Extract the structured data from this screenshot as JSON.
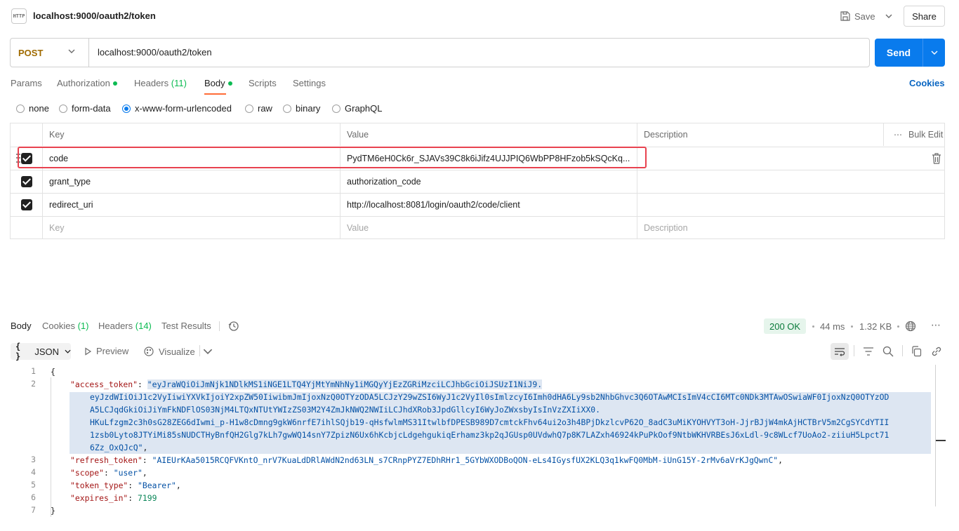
{
  "header": {
    "icon_text": "HTTP",
    "title": "localhost:9000/oauth2/token",
    "save_label": "Save",
    "share_label": "Share"
  },
  "request": {
    "method": "POST",
    "url": "localhost:9000/oauth2/token",
    "send_label": "Send"
  },
  "request_tabs": [
    {
      "label": "Params",
      "active": false
    },
    {
      "label": "Authorization",
      "dot": true
    },
    {
      "label": "Headers",
      "count": "(11)"
    },
    {
      "label": "Body",
      "dot": true,
      "active": true
    },
    {
      "label": "Scripts"
    },
    {
      "label": "Settings"
    }
  ],
  "cookies_link": "Cookies",
  "body_types": [
    {
      "label": "none",
      "selected": false
    },
    {
      "label": "form-data",
      "selected": false
    },
    {
      "label": "x-www-form-urlencoded",
      "selected": true
    },
    {
      "label": "raw",
      "selected": false
    },
    {
      "label": "binary",
      "selected": false
    },
    {
      "label": "GraphQL",
      "selected": false
    }
  ],
  "params_table": {
    "columns": [
      "Key",
      "Value",
      "Description"
    ],
    "bulk_edit_label": "Bulk Edit",
    "rows": [
      {
        "key": "code",
        "value": "PydTM6eH0Ck6r_SJAVs39C8k6iJifz4UJJPIQ6WbPP8HFzob5kSQcKq...",
        "description": "",
        "checked": true
      },
      {
        "key": "grant_type",
        "value": "authorization_code",
        "description": "",
        "checked": true
      },
      {
        "key": "redirect_uri",
        "value": "http://localhost:8081/login/oauth2/code/client",
        "description": "",
        "checked": true
      }
    ],
    "placeholder": {
      "key": "Key",
      "value": "Value",
      "description": "Description"
    }
  },
  "response": {
    "tabs": [
      {
        "label": "Body",
        "active": true
      },
      {
        "label": "Cookies",
        "count": "(1)"
      },
      {
        "label": "Headers",
        "count": "(14)"
      },
      {
        "label": "Test Results"
      }
    ],
    "status": "200 OK",
    "time": "44 ms",
    "size": "1.32 KB",
    "format": "JSON",
    "preview_label": "Preview",
    "visualize_label": "Visualize",
    "status_color": "#0a7a3a"
  },
  "code": {
    "line_numbers": [
      "1",
      "2",
      "3",
      "4",
      "5",
      "6",
      "7"
    ],
    "open_brace": "{",
    "close_brace": "}",
    "access_token_key": "\"access_token\"",
    "access_token_lines": [
      "\"eyJraWQiOiJmNjk1NDlkMS1iNGE1LTQ4YjMtYmNhNy1iMGQyYjEzZGRiMzciLCJhbGciOiJSUzI1NiJ9.",
      "eyJzdWIiOiJ1c2VyIiwiYXVkIjoiY2xpZW50IiwibmJmIjoxNzQ0OTYzODA5LCJzY29wZSI6WyJ1c2VyIl0sImlzcyI6Imh0dHA6Ly9sb2NhbGhvc3Q6OTAwMCIsImV4cCI6MTc0NDk3MTAwOSwiaWF0IjoxNzQ0OTYzOD",
      "A5LCJqdGkiOiJiYmFkNDFlOS03NjM4LTQxNTUtYWIzZS03M2Y4ZmJkNWQ2NWIiLCJhdXRob3JpdGllcyI6WyJoZWxsbyIsInVzZXIiXX0.",
      "HKuLfzgm2c3h0sG28ZEG6dIwmi_p-H1w8cDmng9gkW6nrfE7ihlSQjb19-qHsfwlmMS31ItwlbfDPESB989D7cmtckFhv64ui2o3h4BPjDkzlcvP62O_8adC3uMiKYOHVYT3oH-JjrBJjW4mkAjHCTBrV5m2CgSYCdYTII",
      "1zsb0Lyto8JTYiMi85sNUDCTHyBnfQH2Glg7kLh7gwWQ14snY7ZpizN6Ux6hKcbjcLdgehgukiqErhamz3kp2qJGUsp0UVdwhQ7p8K7LAZxh46924kPuPkOof9NtbWKHVRBEsJ6xLdl-9c8WLcf7UoAo2-ziiuH5Lpct71",
      "6Zz_OxQJcQ\""
    ],
    "refresh_token_key": "\"refresh_token\"",
    "refresh_token_value": "\"AIEUrKAa5015RCQFVKntO_nrV7KuaLdDRlAWdN2nd63LN_s7CRnpPYZ7EDhRHr1_5GYbWXODBoQON-eLs4IGysfUX2KLQ3q1kwFQ0MbM-iUnG15Y-2rMv6aVrKJgQwnC\"",
    "scope_key": "\"scope\"",
    "scope_value": "\"user\"",
    "token_type_key": "\"token_type\"",
    "token_type_value": "\"Bearer\"",
    "expires_in_key": "\"expires_in\"",
    "expires_in_value": "7199"
  }
}
